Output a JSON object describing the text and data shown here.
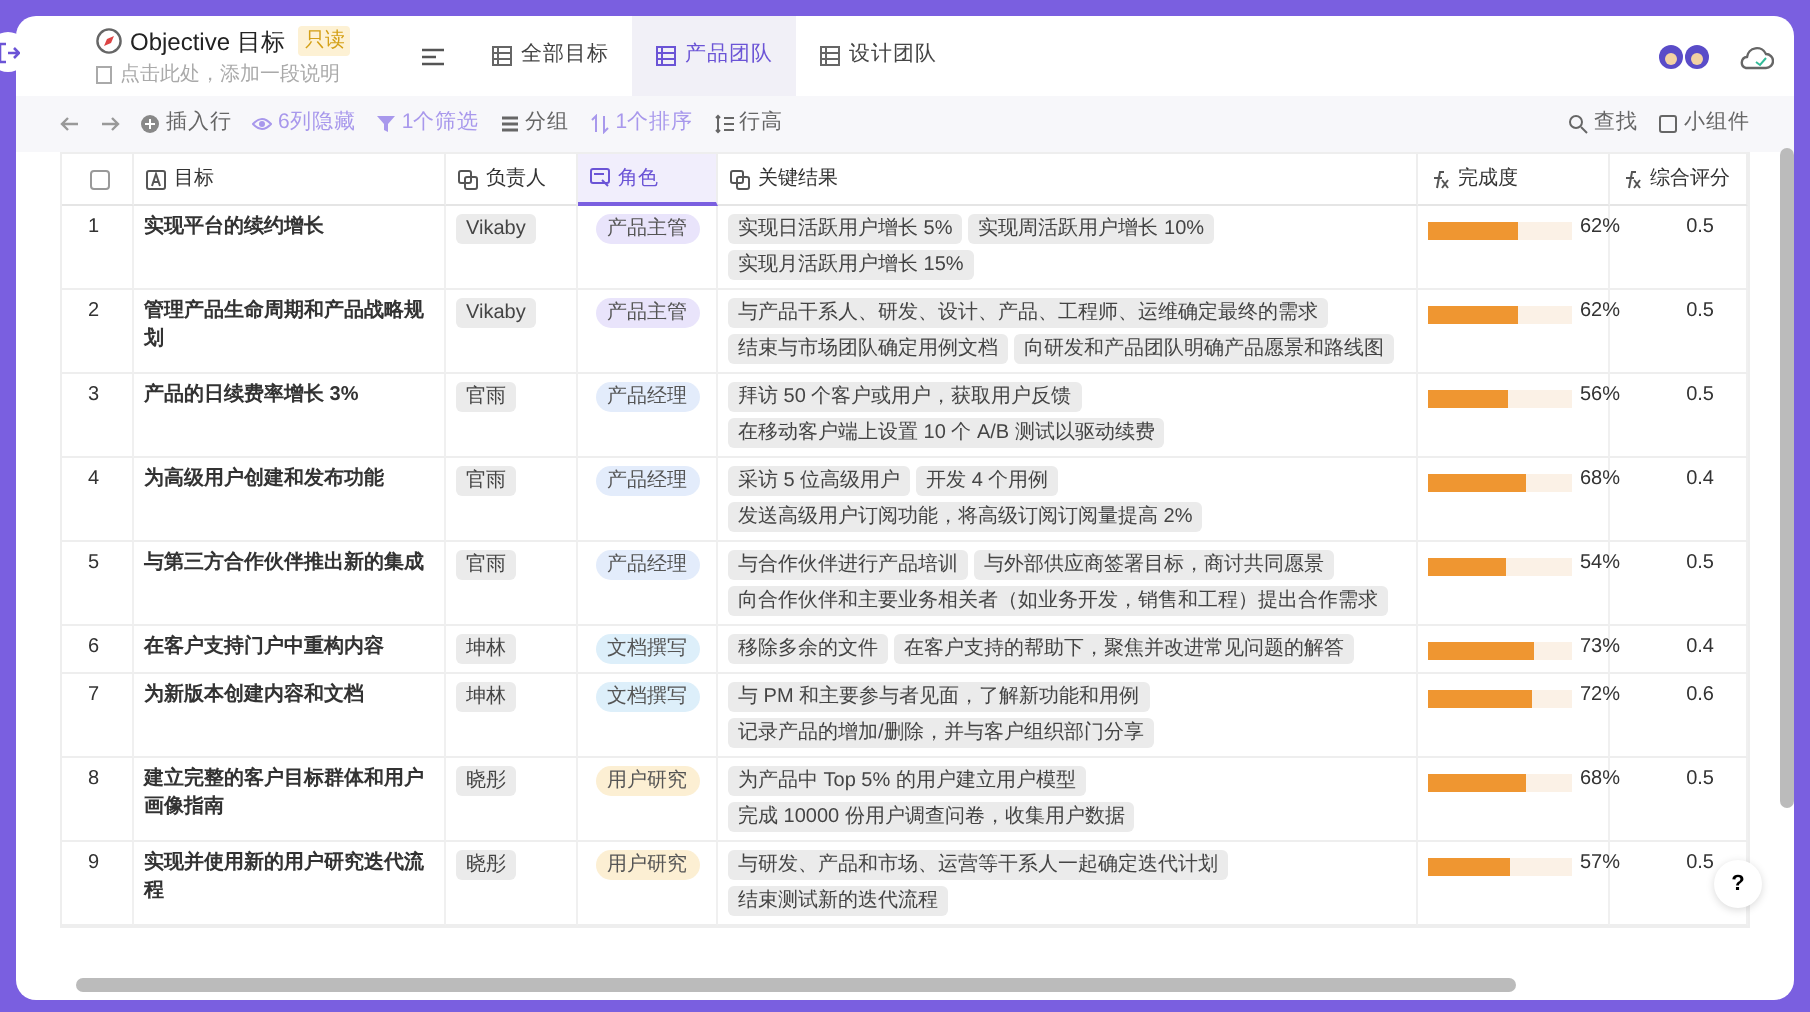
{
  "header": {
    "title": "Objective 目标",
    "badge": "只读",
    "description": "点击此处，添加一段说明"
  },
  "tabs": [
    {
      "label": "全部目标",
      "selected": false
    },
    {
      "label": "产品团队",
      "selected": true
    },
    {
      "label": "设计团队",
      "selected": false
    }
  ],
  "toolbar": [
    {
      "kind": "insert",
      "label": "插入行",
      "highlighted": false
    },
    {
      "kind": "hide",
      "label": "6列隐藏",
      "highlighted": true
    },
    {
      "kind": "filter",
      "label": "1个筛选",
      "highlighted": true
    },
    {
      "kind": "group",
      "label": "分组",
      "highlighted": false
    },
    {
      "kind": "sort",
      "label": "1个排序",
      "highlighted": true
    },
    {
      "kind": "height",
      "label": "行高",
      "highlighted": false
    }
  ],
  "toolbar_right": [
    "查找",
    "小组件"
  ],
  "select_all": {
    "checked": false
  },
  "columns": [
    {
      "kind": "text",
      "label": "目标",
      "selected": false
    },
    {
      "kind": "link",
      "label": "负责人",
      "selected": false
    },
    {
      "kind": "select",
      "label": "角色",
      "selected": true
    },
    {
      "kind": "link",
      "label": "关键结果",
      "selected": false
    },
    {
      "kind": "formula",
      "label": "完成度",
      "selected": false
    },
    {
      "kind": "formula",
      "label": "综合评分",
      "selected": false
    }
  ],
  "rows": [
    {
      "index": "1",
      "objective": "实现平台的续约增长",
      "owner": "Vikaby",
      "role": {
        "label": "产品主管",
        "color": "#e9e4fb"
      },
      "key_results": [
        "实现日活跃用户增长 5%",
        "实现周活跃用户增长 10%",
        "实现月活跃用户增长 15%"
      ],
      "level": 0.62,
      "progress": "62%",
      "score": "0.5"
    },
    {
      "index": "2",
      "objective": "管理产品生命周期和产品战略规划",
      "owner": "Vikaby",
      "role": {
        "label": "产品主管",
        "color": "#e9e4fb"
      },
      "key_results": [
        "与产品干系人、研发、设计、产品、工程师、运维确定最终的需求",
        "结束与市场团队确定用例文档",
        "向研发和产品团队明确产品愿景和路线图"
      ],
      "level": 0.62,
      "progress": "62%",
      "score": "0.5"
    },
    {
      "index": "3",
      "objective": "产品的日续费率增长 3%",
      "owner": "官雨",
      "role": {
        "label": "产品经理",
        "color": "#e3ecfb"
      },
      "key_results": [
        "拜访 50 个客户或用户，获取用户反馈",
        "在移动客户端上设置 10 个 A/B 测试以驱动续费"
      ],
      "level": 0.56,
      "progress": "56%",
      "score": "0.5"
    },
    {
      "index": "4",
      "objective": "为高级用户创建和发布功能",
      "owner": "官雨",
      "role": {
        "label": "产品经理",
        "color": "#e3ecfb"
      },
      "key_results": [
        "采访 5 位高级用户",
        "开发 4 个用例",
        "发送高级用户订阅功能，将高级订阅订阅量提高 2%"
      ],
      "level": 0.68,
      "progress": "68%",
      "score": "0.4"
    },
    {
      "index": "5",
      "objective": "与第三方合作伙伴推出新的集成",
      "owner": "官雨",
      "role": {
        "label": "产品经理",
        "color": "#e3ecfb"
      },
      "key_results": [
        "与合作伙伴进行产品培训",
        "与外部供应商签署目标，商讨共同愿景",
        "向合作伙伴和主要业务相关者（如业务开发，销售和工程）提出合作需求"
      ],
      "level": 0.54,
      "progress": "54%",
      "score": "0.5"
    },
    {
      "index": "6",
      "objective": "在客户支持门户中重构内容",
      "owner": "坤林",
      "role": {
        "label": "文档撰写",
        "color": "#ddeffa"
      },
      "key_results": [
        "移除多余的文件",
        "在客户支持的帮助下，聚焦并改进常见问题的解答"
      ],
      "level": 0.73,
      "progress": "73%",
      "score": "0.4"
    },
    {
      "index": "7",
      "objective": "为新版本创建内容和文档",
      "owner": "坤林",
      "role": {
        "label": "文档撰写",
        "color": "#ddeffa"
      },
      "key_results": [
        "与 PM 和主要参与者见面，了解新功能和用例",
        "记录产品的增加/删除，并与客户组织部门分享"
      ],
      "level": 0.72,
      "progress": "72%",
      "score": "0.6"
    },
    {
      "index": "8",
      "objective": "建立完整的客户目标群体和用户画像指南",
      "owner": "晓彤",
      "role": {
        "label": "用户研究",
        "color": "#fcefd3"
      },
      "key_results": [
        "为产品中 Top 5% 的用户建立用户模型",
        "完成 10000 份用户调查问卷，收集用户数据"
      ],
      "level": 0.68,
      "progress": "68%",
      "score": "0.5"
    },
    {
      "index": "9",
      "objective": "实现并使用新的用户研究迭代流程",
      "owner": "晓彤",
      "role": {
        "label": "用户研究",
        "color": "#fcefd3"
      },
      "key_results": [
        "与研发、产品和市场、运营等干系人一起确定迭代计划",
        "结束测试新的迭代流程"
      ],
      "level": 0.57,
      "progress": "57%",
      "score": "0.5"
    }
  ],
  "help_button": "?"
}
